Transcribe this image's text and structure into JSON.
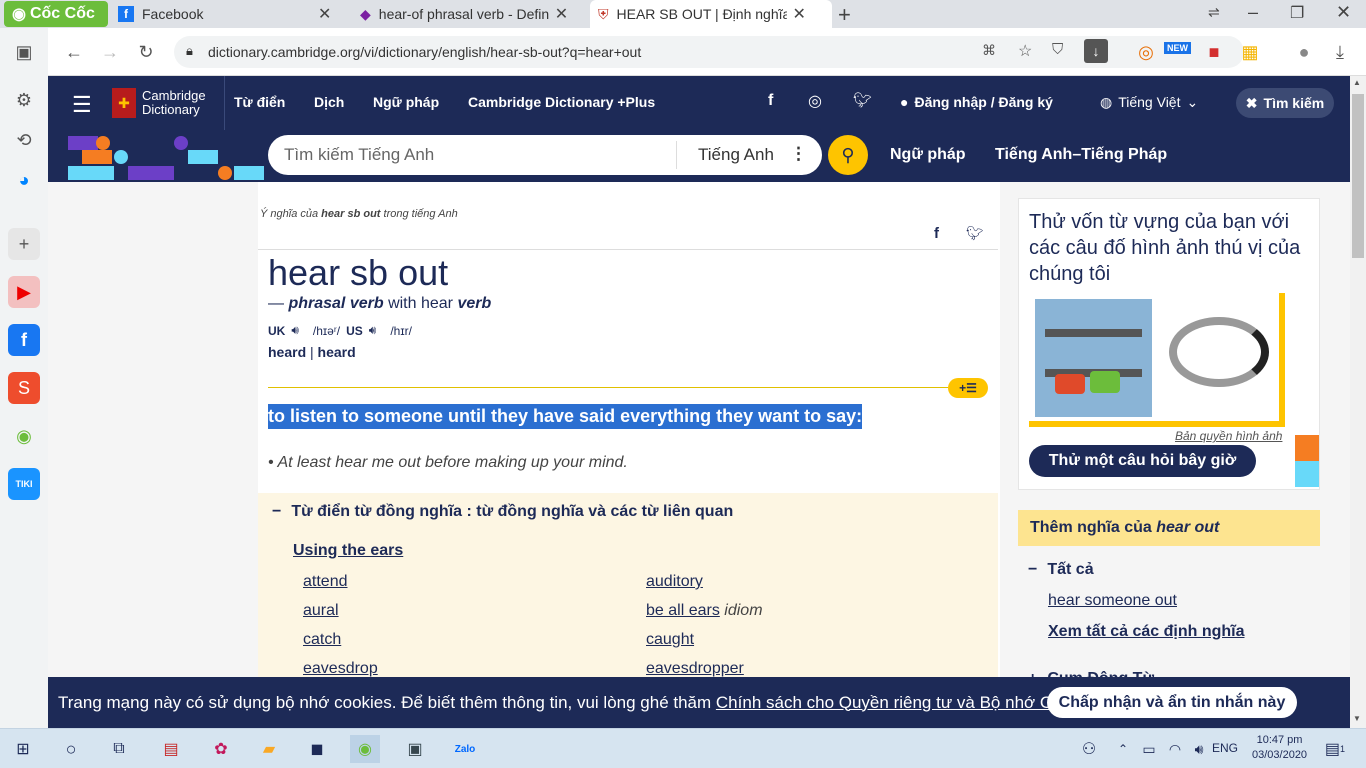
{
  "browser": {
    "brand": "Cốc Cốc",
    "tabs": [
      {
        "title": "Facebook"
      },
      {
        "title": "hear-of phrasal verb - Definiti"
      },
      {
        "title": "HEAR SB OUT | Định nghĩa tro"
      }
    ],
    "new_tab": "+",
    "url": "dictionary.cambridge.org/vi/dictionary/english/hear-sb-out?q=hear+out",
    "ext_new_badge": "NEW"
  },
  "site": {
    "logo_line1": "Cambridge",
    "logo_line2": "Dictionary",
    "nav": [
      "Từ điển",
      "Dịch",
      "Ngữ pháp",
      "Cambridge Dictionary +Plus"
    ],
    "login": "Đăng nhập / Đăng ký",
    "language": "Tiếng Việt",
    "search_toggle": "Tìm kiếm",
    "search_placeholder": "Tìm kiếm Tiếng Anh",
    "search_lang": "Tiếng Anh",
    "nav2": [
      "Ngữ pháp",
      "Tiếng Anh–Tiếng Pháp"
    ]
  },
  "entry": {
    "meaning_of_prefix": "Ý nghĩa của",
    "meaning_of_word": "hear sb out",
    "meaning_of_suffix": "trong tiếng Anh",
    "headword": "hear sb out",
    "pos_dash": "—",
    "pos": "phrasal verb",
    "with_text": "with hear",
    "with_pos": "verb",
    "uk_label": "UK",
    "uk_ipa": "/hɪəʳ/",
    "us_label": "US",
    "us_ipa": "/hɪr/",
    "forms": [
      "heard",
      "heard"
    ],
    "definition": "to listen to someone until they have said everything they want to say:",
    "example": "At least hear me out before making up your mind.",
    "thesaurus_title": "Từ điển từ đồng nghĩa : từ đồng nghĩa và các từ liên quan",
    "thesaurus_group": "Using the ears",
    "words_left": [
      "attend",
      "aural",
      "catch",
      "eavesdrop"
    ],
    "words_right": [
      "auditory",
      "be all ears",
      "caught",
      "eavesdropper"
    ],
    "idiom_label": "idiom"
  },
  "aside": {
    "quiz_text": "Thử vốn từ vựng của bạn với các câu đố hình ảnh thú vị của chúng tôi",
    "copyright": "Bản quyền hình ảnh",
    "quiz_button": "Thử một câu hỏi bây giờ",
    "more_title_prefix": "Thêm nghĩa của",
    "more_title_word": "hear out",
    "all_label": "Tất cả",
    "link1": "hear someone out",
    "link2": "Xem tất cả các định nghĩa",
    "next_section": "Cụm Động Từ"
  },
  "cookie": {
    "text": "Trang mạng này có sử dụng bộ nhớ cookies. Để biết thêm thông tin, vui lòng ghé thăm",
    "link": "Chính sách cho Quyền riêng tư và Bộ nhớ Cookies",
    "period": ".",
    "button": "Chấp nhận và ẩn tin nhắn này"
  },
  "taskbar": {
    "lang": "ENG",
    "time": "10:47 pm",
    "date": "03/03/2020",
    "notif": "1"
  },
  "colors": {
    "navy": "#1d2a57",
    "yellow": "#fec400",
    "highlight": "#2b6fd1",
    "thesaurus_bg": "#fdf6e3"
  }
}
